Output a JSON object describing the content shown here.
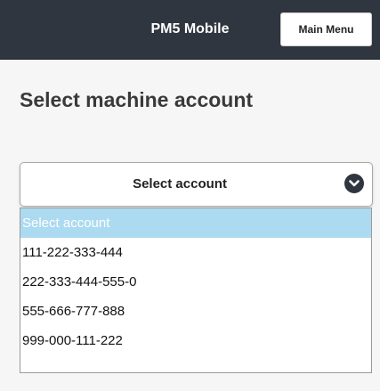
{
  "header": {
    "title": "PM5 Mobile",
    "main_menu_label": "Main Menu",
    "background_color": "#2f3640"
  },
  "page": {
    "title": "Select machine account"
  },
  "account_select": {
    "selected_label": "Select account",
    "icon": "chevron-down-circle-icon",
    "options": [
      {
        "label": "Select account",
        "highlighted": true
      },
      {
        "label": "111-222-333-444",
        "highlighted": false
      },
      {
        "label": "222-333-444-555-0",
        "highlighted": false
      },
      {
        "label": "555-666-777-888",
        "highlighted": false
      },
      {
        "label": "999-000-111-222",
        "highlighted": false
      }
    ],
    "highlight_color": "#acdaf1"
  }
}
